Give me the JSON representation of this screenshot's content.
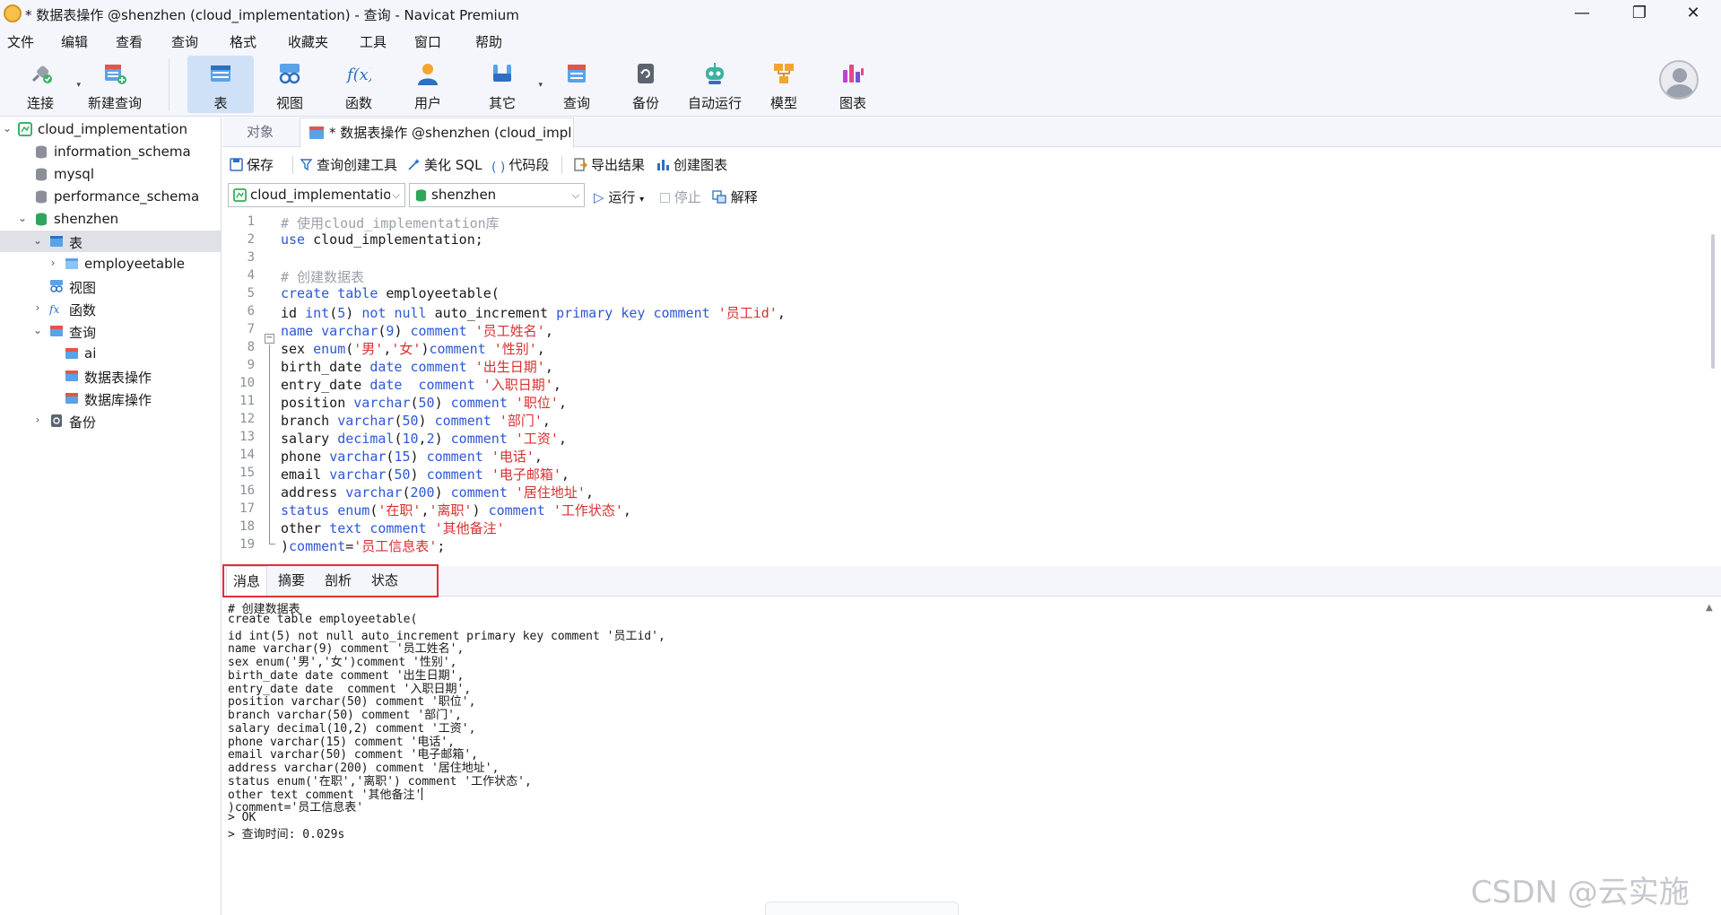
{
  "window": {
    "title": "* 数据表操作 @shenzhen (cloud_implementation) - 查询 - Navicat Premium",
    "minimize": "—",
    "maximize": "❐",
    "close": "✕"
  },
  "menu": [
    "文件",
    "编辑",
    "查看",
    "查询",
    "格式",
    "收藏夹",
    "工具",
    "窗口",
    "帮助"
  ],
  "toolbar": {
    "connect": "连接",
    "new_query": "新建查询",
    "table": "表",
    "view": "视图",
    "function": "函数",
    "user": "用户",
    "other": "其它",
    "query": "查询",
    "backup": "备份",
    "auto_run": "自动运行",
    "model": "模型",
    "chart": "图表"
  },
  "sidebar": {
    "connection": "cloud_implementation",
    "db_information_schema": "information_schema",
    "db_mysql": "mysql",
    "db_performance_schema": "performance_schema",
    "db_shenzhen": "shenzhen",
    "folder_tables": "表",
    "table_employeetable": "employeetable",
    "folder_views": "视图",
    "folder_functions": "函数",
    "folder_queries": "查询",
    "query_ai": "ai",
    "query_table_ops": "数据表操作",
    "query_db_ops": "数据库操作",
    "folder_backup": "备份"
  },
  "tabs": {
    "objects": "对象",
    "query_tab": "* 数据表操作 @shenzhen (cloud_impl..."
  },
  "query_toolbar": {
    "save": "保存",
    "query_builder": "查询创建工具",
    "beautify": "美化 SQL",
    "snippet": "代码段",
    "export": "导出结果",
    "create_chart": "创建图表"
  },
  "selectors": {
    "connection": "cloud_implementation",
    "database": "shenzhen",
    "run": "运行",
    "stop": "停止",
    "explain": "解释"
  },
  "editor": {
    "line_numbers": [
      "1",
      "2",
      "3",
      "4",
      "5",
      "6",
      "7",
      "8",
      "9",
      "10",
      "11",
      "12",
      "13",
      "14",
      "15",
      "16",
      "17",
      "18",
      "19"
    ]
  },
  "result_tabs": {
    "messages": "消息",
    "summary": "摘要",
    "profile": "剖析",
    "status": "状态"
  },
  "messages": [
    "# 创建数据表",
    "create table employeetable(",
    "id int(5) not null auto_increment primary key comment '员工id',",
    "name varchar(9) comment '员工姓名',",
    "sex enum('男','女')comment '性别',",
    "birth_date date comment '出生日期',",
    "entry_date date  comment '入职日期',",
    "position varchar(50) comment '职位',",
    "branch varchar(50) comment '部门',",
    "salary decimal(10,2) comment '工资',",
    "phone varchar(15) comment '电话',",
    "email varchar(50) comment '电子邮箱',",
    "address varchar(200) comment '居住地址',",
    "status enum('在职','离职') comment '工作状态',",
    "other text comment '其他备注'",
    ")comment='员工信息表'",
    "> OK",
    "> 查询时间: 0.029s"
  ],
  "watermark": "CSDN @云实施",
  "colors": {
    "keyword": "#2c58d6",
    "string": "#d92f2f",
    "comment": "#9aa0aa",
    "highlight_box": "#e0303a",
    "selection": "#cfe1f7"
  }
}
